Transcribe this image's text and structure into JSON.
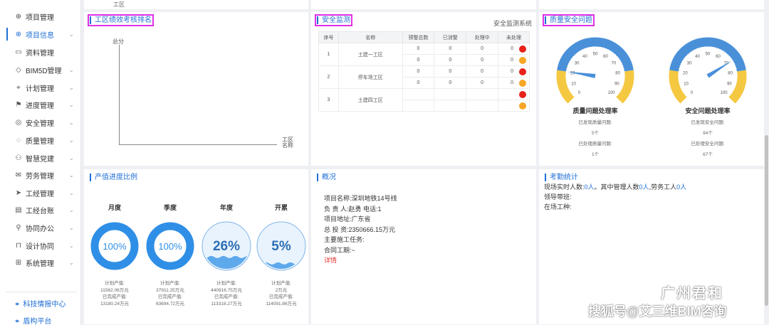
{
  "sidebar": {
    "items": [
      {
        "label": "项目管理",
        "icon": "crosshair-icon",
        "glyph": "⊕",
        "has_children": false
      },
      {
        "label": "项目信息",
        "icon": "globe-icon",
        "glyph": "⊕",
        "has_children": true
      },
      {
        "label": "资料管理",
        "icon": "folder-icon",
        "glyph": "▭",
        "has_children": false
      },
      {
        "label": "BIM5D管理",
        "icon": "tag-icon",
        "glyph": "◇",
        "has_children": true
      },
      {
        "label": "计划管理",
        "icon": "pin-icon",
        "glyph": "⌖",
        "has_children": true
      },
      {
        "label": "进度管理",
        "icon": "flag-icon",
        "glyph": "⚑",
        "has_children": true
      },
      {
        "label": "安全管理",
        "icon": "safety-icon",
        "glyph": "◎",
        "has_children": true
      },
      {
        "label": "质量管理",
        "icon": "bulb-icon",
        "glyph": "◌",
        "has_children": true
      },
      {
        "label": "智慧党建",
        "icon": "users-icon",
        "glyph": "⚇",
        "has_children": true
      },
      {
        "label": "劳务管理",
        "icon": "mail-icon",
        "glyph": "✉",
        "has_children": true
      },
      {
        "label": "工经管理",
        "icon": "send-icon",
        "glyph": "➤",
        "has_children": true
      },
      {
        "label": "工经台账",
        "icon": "wallet-icon",
        "glyph": "▤",
        "has_children": true
      },
      {
        "label": "协同办公",
        "icon": "user-icon",
        "glyph": "⚲",
        "has_children": true
      },
      {
        "label": "设计协同",
        "icon": "design-icon",
        "glyph": "⊓",
        "has_children": true
      },
      {
        "label": "系统管理",
        "icon": "grid-icon",
        "glyph": "⊞",
        "has_children": true
      }
    ],
    "active_index": 1,
    "bottom_links": [
      {
        "label": "科技情报中心",
        "icon": "link-icon"
      },
      {
        "label": "盾构平台",
        "icon": "link-icon"
      }
    ]
  },
  "top_strip": {
    "axis_label": "工区"
  },
  "performance": {
    "title": "工区绩效考核排名",
    "y_label": "总分",
    "x_label_1": "工区",
    "x_label_2": "名称"
  },
  "safety": {
    "title": "安全监测",
    "system_name": "安全监测系统",
    "columns": [
      "序号",
      "名称",
      "预警总数",
      "已消警",
      "处理中",
      "未处理"
    ],
    "rows": [
      {
        "no": "1",
        "name": "土建一工区",
        "sub": [
          [
            "0",
            "0",
            "0",
            "0",
            "red"
          ],
          [
            "0",
            "0",
            "0",
            "0",
            "orange"
          ]
        ]
      },
      {
        "no": "2",
        "name": "停车场工区",
        "sub": [
          [
            "0",
            "0",
            "0",
            "0",
            "red"
          ],
          [
            "0",
            "0",
            "0",
            "0",
            "orange"
          ]
        ]
      },
      {
        "no": "3",
        "name": "土建四工区",
        "sub": [
          [
            "",
            "",
            "",
            "",
            "red"
          ],
          [
            "",
            "",
            "",
            "",
            "orange"
          ]
        ]
      }
    ],
    "colors": {
      "red": "#e8211a",
      "orange": "#f5a623"
    }
  },
  "quality": {
    "title": "质量安全问题",
    "gauge_ticks": [
      "0",
      "10",
      "20",
      "30",
      "40",
      "50",
      "60",
      "70",
      "80",
      "90",
      "100"
    ],
    "gauges": [
      {
        "name": "质量问题处理率",
        "found_label": "已发现质量问题:",
        "found": "5个",
        "handled_label": "已处理质量问题:",
        "handled": "1个",
        "rate": 20
      },
      {
        "name": "安全问题处理率",
        "found_label": "已发现安全问题:",
        "found": "94个",
        "handled_label": "已处理安全问题:",
        "handled": "67个",
        "rate": 71.28
      }
    ],
    "colors": {
      "low": "#f5c842",
      "mid": "#4a90d9",
      "high": "#f5c842"
    }
  },
  "progress": {
    "title": "产值进度比例",
    "rings": [
      {
        "label": "月度",
        "value_text": "100%",
        "fraction": 1.0,
        "style": "ring",
        "plan_label": "计划产值:",
        "plan": "11562.06万元",
        "done_label": "已完成产值:",
        "done": "13180.24万元"
      },
      {
        "label": "季度",
        "value_text": "100%",
        "fraction": 1.0,
        "style": "ring",
        "plan_label": "计划产值:",
        "plan": "37911.25万元",
        "done_label": "已完成产值:",
        "done": "63694.72万元"
      },
      {
        "label": "年度",
        "value_text": "26%",
        "fraction": 0.26,
        "style": "wave",
        "plan_label": "计划产值:",
        "plan": "440916.75万元",
        "done_label": "已完成产值:",
        "done": "113318.27万元"
      },
      {
        "label": "开累",
        "value_text": "5%",
        "fraction": 0.05,
        "style": "wave",
        "plan_label": "计划产值:",
        "plan": "2万元",
        "done_label": "已完成产值:",
        "done": "114091.86万元"
      }
    ],
    "color": "#2f8fe6"
  },
  "overview": {
    "title": "概况",
    "lines": [
      "项目名称:深圳地铁14号线",
      "负 责 人:赵勇       电话:1",
      "项目地址:广东省",
      "总 投 资:2350666.15万元",
      "主要施工任务:",
      "合同工期:~"
    ],
    "detail_link": "详情"
  },
  "attendance": {
    "title": "考勤统计",
    "l1_a": "现场实时人数:",
    "l1_b": "0人",
    "l1_c": "。其中管理人数",
    "l1_d": "0人",
    "l1_e": ",劳务工人",
    "l1_f": "0人",
    "l2": "领导带班:",
    "l3": "在场工种:"
  },
  "watermarks": {
    "brand": "广州君和",
    "source": "搜狐号@艾三维BIM咨询"
  }
}
